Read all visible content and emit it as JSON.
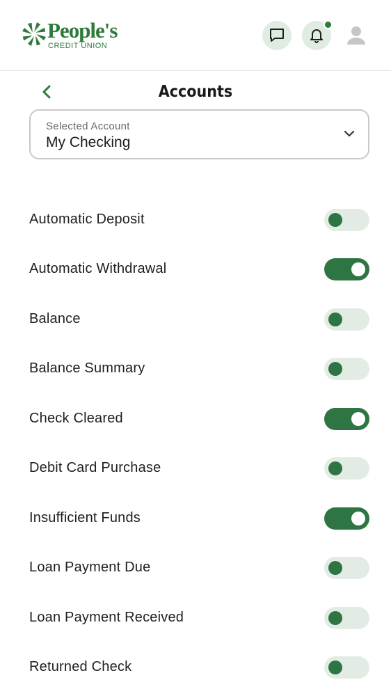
{
  "brand": {
    "name": "People's",
    "subtitle": "CREDIT UNION",
    "accent_color": "#2d7a3a"
  },
  "header": {
    "messages_icon": "chat-bubble-icon",
    "notifications_icon": "bell-icon",
    "profile_icon": "user-icon"
  },
  "page": {
    "title": "Accounts"
  },
  "account_select": {
    "label": "Selected Account",
    "value": "My Checking"
  },
  "alerts": [
    {
      "label": "Automatic Deposit",
      "enabled": false
    },
    {
      "label": "Automatic Withdrawal",
      "enabled": true
    },
    {
      "label": "Balance",
      "enabled": false
    },
    {
      "label": "Balance Summary",
      "enabled": false
    },
    {
      "label": "Check Cleared",
      "enabled": true
    },
    {
      "label": "Debit Card Purchase",
      "enabled": false
    },
    {
      "label": "Insufficient Funds",
      "enabled": true
    },
    {
      "label": "Loan Payment Due",
      "enabled": false
    },
    {
      "label": "Loan Payment Received",
      "enabled": false
    },
    {
      "label": "Returned Check",
      "enabled": false
    }
  ]
}
